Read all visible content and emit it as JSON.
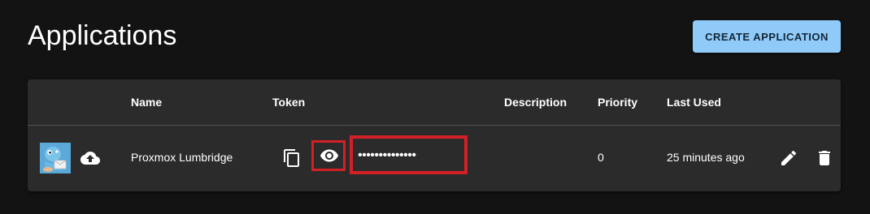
{
  "page": {
    "title": "Applications",
    "create_button_label": "CREATE APPLICATION"
  },
  "table": {
    "columns": [
      "Name",
      "Token",
      "Description",
      "Priority",
      "Last Used"
    ],
    "rows": [
      {
        "name": "Proxmox Lumbridge",
        "token": "••••••••••••••",
        "description": "",
        "priority": "0",
        "last_used": "25 minutes ago",
        "image_icon": "gotify-logo-icon",
        "actions": [
          "upload-icon",
          "copy-icon",
          "eye-icon",
          "edit-icon",
          "delete-icon"
        ]
      }
    ]
  },
  "colors": {
    "background": "#131313",
    "card": "#2b2b2b",
    "accent_button": "#90caf9",
    "highlight_border": "#d32027"
  }
}
